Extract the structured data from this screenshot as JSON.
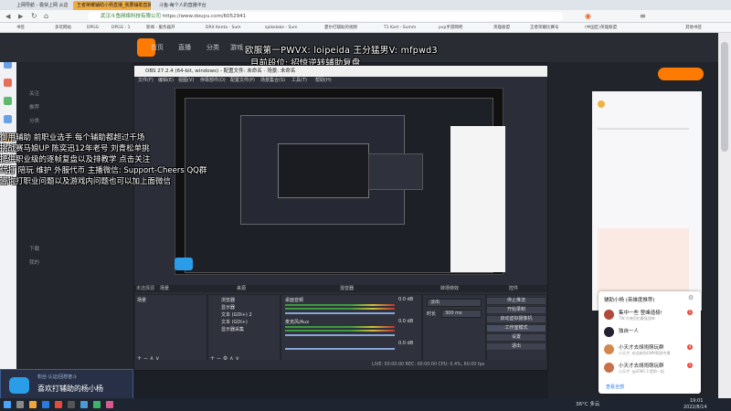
{
  "browser": {
    "tabs": [
      "上网导航 - 极快上网 从这里开始",
      "王者荣耀辅助小杨直播_我要辅助直播",
      "斗鱼-每个人的直播平台"
    ],
    "url": "https://www.douyu.com/6052941",
    "url_domain": "武汉斗鱼网络科技有限公司",
    "bookmarks": [
      "书签",
      "多玩网站",
      "DPGG",
      "DPGG - 1",
      "新闻 - 服务器开",
      "DRX Kenta - Sum",
      "spikelake - Sum",
      "夏尔打辅助的视频",
      "T1 Kart - Summ",
      "pvp手游网吧",
      "英雄联盟",
      "王者荣耀比赛号",
      "(中国区)英雄联盟",
      "其他书签"
    ]
  },
  "site": {
    "nav": [
      "首页",
      "直播",
      "分类",
      "游戏"
    ],
    "overlay_title": "欧服第一PWVX: loipeida  王分猛男V: mfpwd3",
    "overlay_sub": "目前段位: 招惊逆转辅助复盘"
  },
  "left_overlay_lines": [
    "御用辅助 前职业选手 每个辅助都超过千场",
    "挑战赛马娘UP 陈奕迅12年老号 刘青松单挑",
    "提供职业级的逐帧复盘以及排教学 点击关注",
    "代打 陪玩 维护 外服代币 主播微信: Support-Cheers  QQ群",
    "咨询打职业问题以及游戏内问题也可以加上面微信"
  ],
  "left_nav": [
    "关注",
    "推荐",
    "分类",
    "下载",
    "我的"
  ],
  "obs": {
    "title": "OBS 27.2.4 (64-bit, windows) - 配置文件: 未命名 - 场景: 未命名",
    "menu": [
      "文件(F)",
      "编辑(E)",
      "视图(V)",
      "停靠部件(D)",
      "配置文件(P)",
      "场景集合(S)",
      "工具(T)",
      "帮助(H)"
    ],
    "panel_headers": [
      "场景",
      "来源",
      "混音器",
      "转场特效",
      "控件"
    ],
    "scene": "场景",
    "scene_label": "未选择源",
    "sources": [
      "浏览器",
      "显示器",
      "文本 (GDI+) 2",
      "文本 (GDI+)",
      "显示器采集"
    ],
    "mixer": [
      "桌面音频",
      "麦克风/Aux"
    ],
    "mixer_db": [
      "0.0 dB",
      "0.0 dB",
      "0.0 dB"
    ],
    "transition": [
      "淡出",
      "时长",
      "300 ms"
    ],
    "controls": [
      "停止推流",
      "开始录制",
      "启动虚拟摄像机",
      "工作室模式",
      "设置",
      "退出"
    ],
    "status": "LIVE: 00:00:00   REC: 00:00:00   CPU: 0.4%, 60.00 fps"
  },
  "chat_popup": {
    "title": "辅助小杨 (英雄度推荐)",
    "items": [
      {
        "name": "集中一些 登峰造极!",
        "sub": "TW:大帝回忆最强战神",
        "badge": "1"
      },
      {
        "name": "独自一人",
        "sub": "",
        "badge": ""
      },
      {
        "name": "小天才去胡闹萌玩群",
        "sub": "小天才: 欢迎来到GMM帮助专属",
        "badge": "4"
      },
      {
        "name": "小天才去胡闹萌玩群",
        "sub": "小天才: @2080 3 提前一起",
        "badge": "1"
      }
    ],
    "footer": "查看全部"
  },
  "toast": {
    "line1": "粉丝·认证/回想奋斗",
    "line2": "喜欢打辅助的杨小杨"
  },
  "taskbar": {
    "weather": "36°C 多云",
    "time": "19:01",
    "date": "2022/8/14"
  }
}
